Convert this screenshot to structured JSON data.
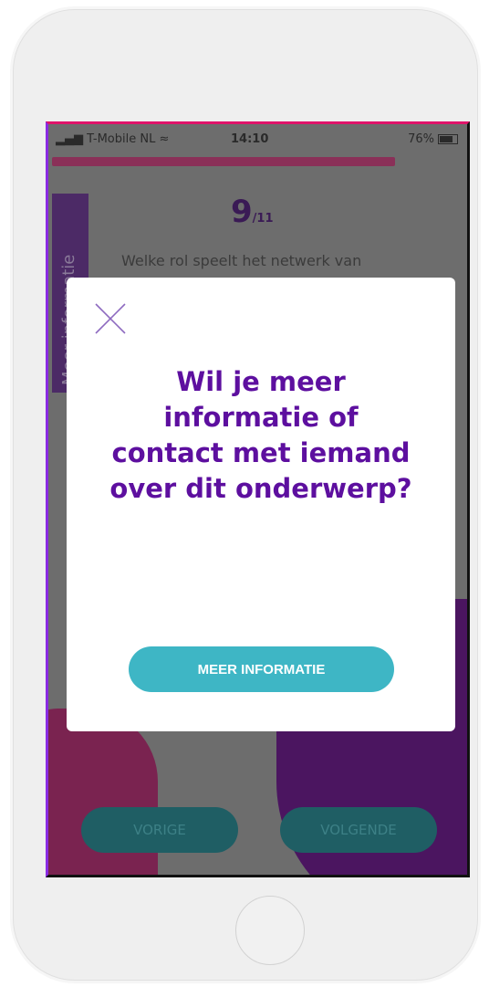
{
  "status_bar": {
    "carrier": "T-Mobile NL",
    "time": "14:10",
    "battery": "76%"
  },
  "progress": {
    "current": 9,
    "total": 11,
    "current_label": "9",
    "total_label": "/11"
  },
  "side_tab": {
    "label": "Meer informatie"
  },
  "question": {
    "text": "Welke rol speelt het netwerk van"
  },
  "modal": {
    "title": "Wil je meer informatie of contact met iemand over dit onderwerp?",
    "button_label": "MEER INFORMATIE"
  },
  "navigation": {
    "prev_label": "VORIGE",
    "next_label": "VOLGENDE"
  },
  "colors": {
    "accent_purple": "#5d0f9f",
    "button_teal": "#3eb6c5",
    "progress_pink": "#8a3058"
  },
  "icons": [
    "signal-icon",
    "wifi-icon",
    "battery-icon",
    "close-icon"
  ]
}
